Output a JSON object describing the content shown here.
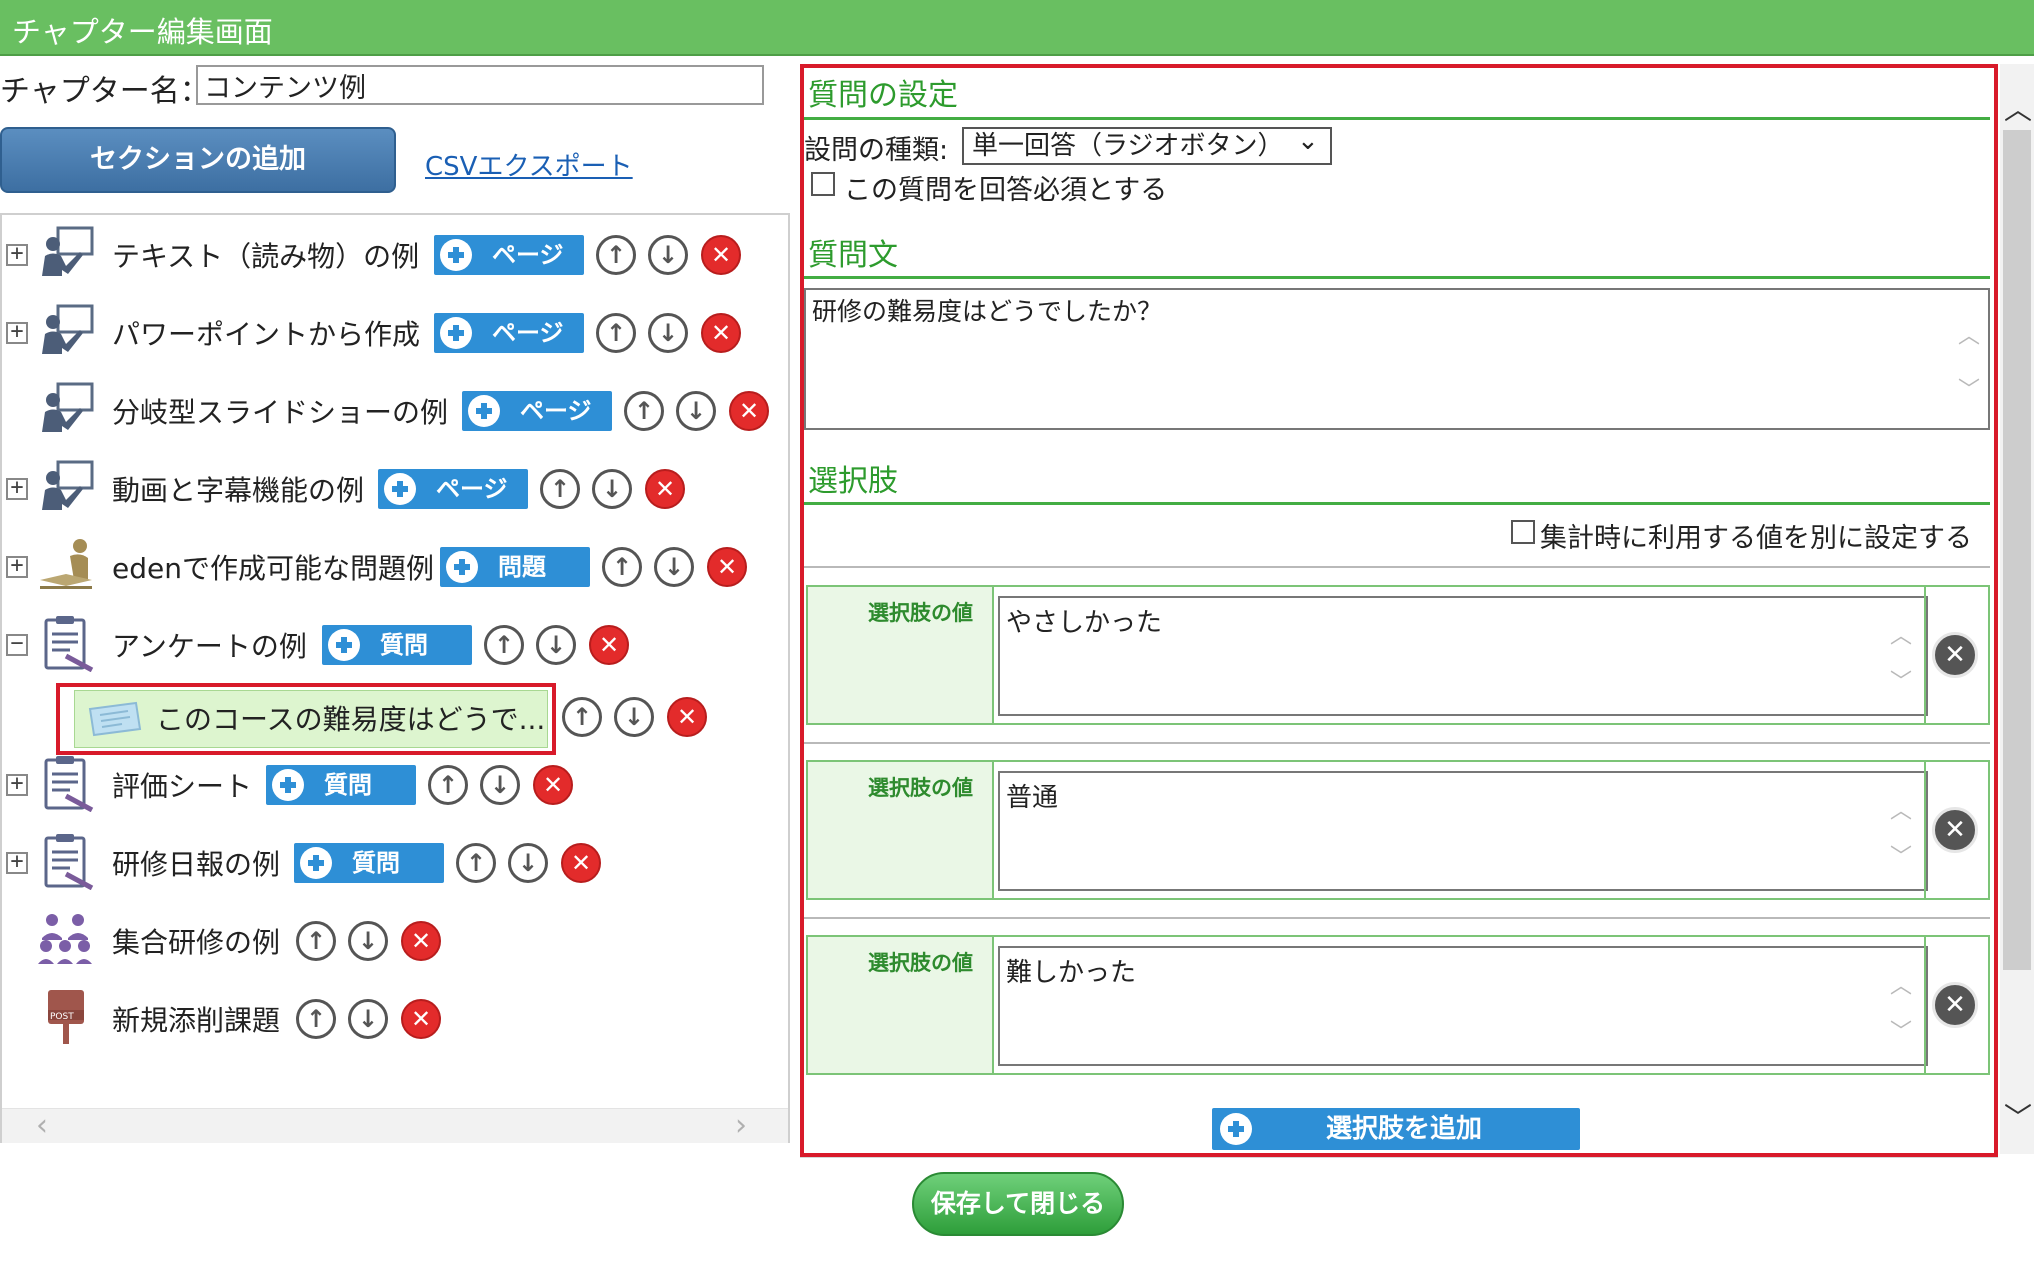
{
  "window": {
    "title": "チャプター編集画面"
  },
  "chapter": {
    "name_label": "チャプター名：",
    "name_value": "コンテンツ例"
  },
  "toolbar": {
    "add_section_label": "セクションの追加",
    "csv_export_label": "CSVエクスポート"
  },
  "tree": {
    "items": [
      {
        "label": "テキスト（読み物）の例",
        "add_label": "ページ",
        "expander": "+",
        "icon": "presenter-icon"
      },
      {
        "label": "パワーポイントから作成",
        "add_label": "ページ",
        "expander": "+",
        "icon": "presenter-icon"
      },
      {
        "label": "分岐型スライドショーの例",
        "add_label": "ページ",
        "expander": "",
        "icon": "presenter-icon"
      },
      {
        "label": "動画と字幕機能の例",
        "add_label": "ページ",
        "expander": "+",
        "icon": "presenter-icon"
      },
      {
        "label": "edenで作成可能な問題例",
        "add_label": "問題",
        "expander": "+",
        "icon": "exam-person-icon"
      },
      {
        "label": "アンケートの例",
        "add_label": "質問",
        "expander": "−",
        "icon": "clipboard-icon"
      },
      {
        "label": "このコースの難易度はどうで...",
        "add_label": "",
        "expander": "",
        "icon": "question-card-icon"
      },
      {
        "label": "評価シート",
        "add_label": "質問",
        "expander": "+",
        "icon": "clipboard-icon"
      },
      {
        "label": "研修日報の例",
        "add_label": "質問",
        "expander": "+",
        "icon": "clipboard-icon"
      },
      {
        "label": "集合研修の例",
        "add_label": "",
        "expander": "",
        "icon": "group-icon"
      },
      {
        "label": "新規添削課題",
        "add_label": "",
        "expander": "",
        "icon": "postbox-icon"
      }
    ]
  },
  "question_settings": {
    "section_title": "質問の設定",
    "type_label": "設問の種類:",
    "type_value": "単一回答（ラジオボタン）",
    "required_label": "この質問を回答必須とする"
  },
  "question_text": {
    "section_title": "質問文",
    "value": "研修の難易度はどうでしたか？"
  },
  "choices": {
    "section_title": "選択肢",
    "aggregate_label": "集計時に利用する値を別に設定する",
    "value_label": "選択肢の値",
    "items": [
      "やさしかった",
      "普通",
      "難しかった"
    ],
    "add_label": "選択肢を追加"
  },
  "footer": {
    "save_close_label": "保存して閉じる"
  },
  "colors": {
    "title_bar": "#69bf61",
    "section_green": "#2d9b2d",
    "selection_red": "#d81a2a",
    "action_blue": "#2e8fd6",
    "primary_button": "#3d6fa2",
    "delete_red": "#e32b2b"
  }
}
